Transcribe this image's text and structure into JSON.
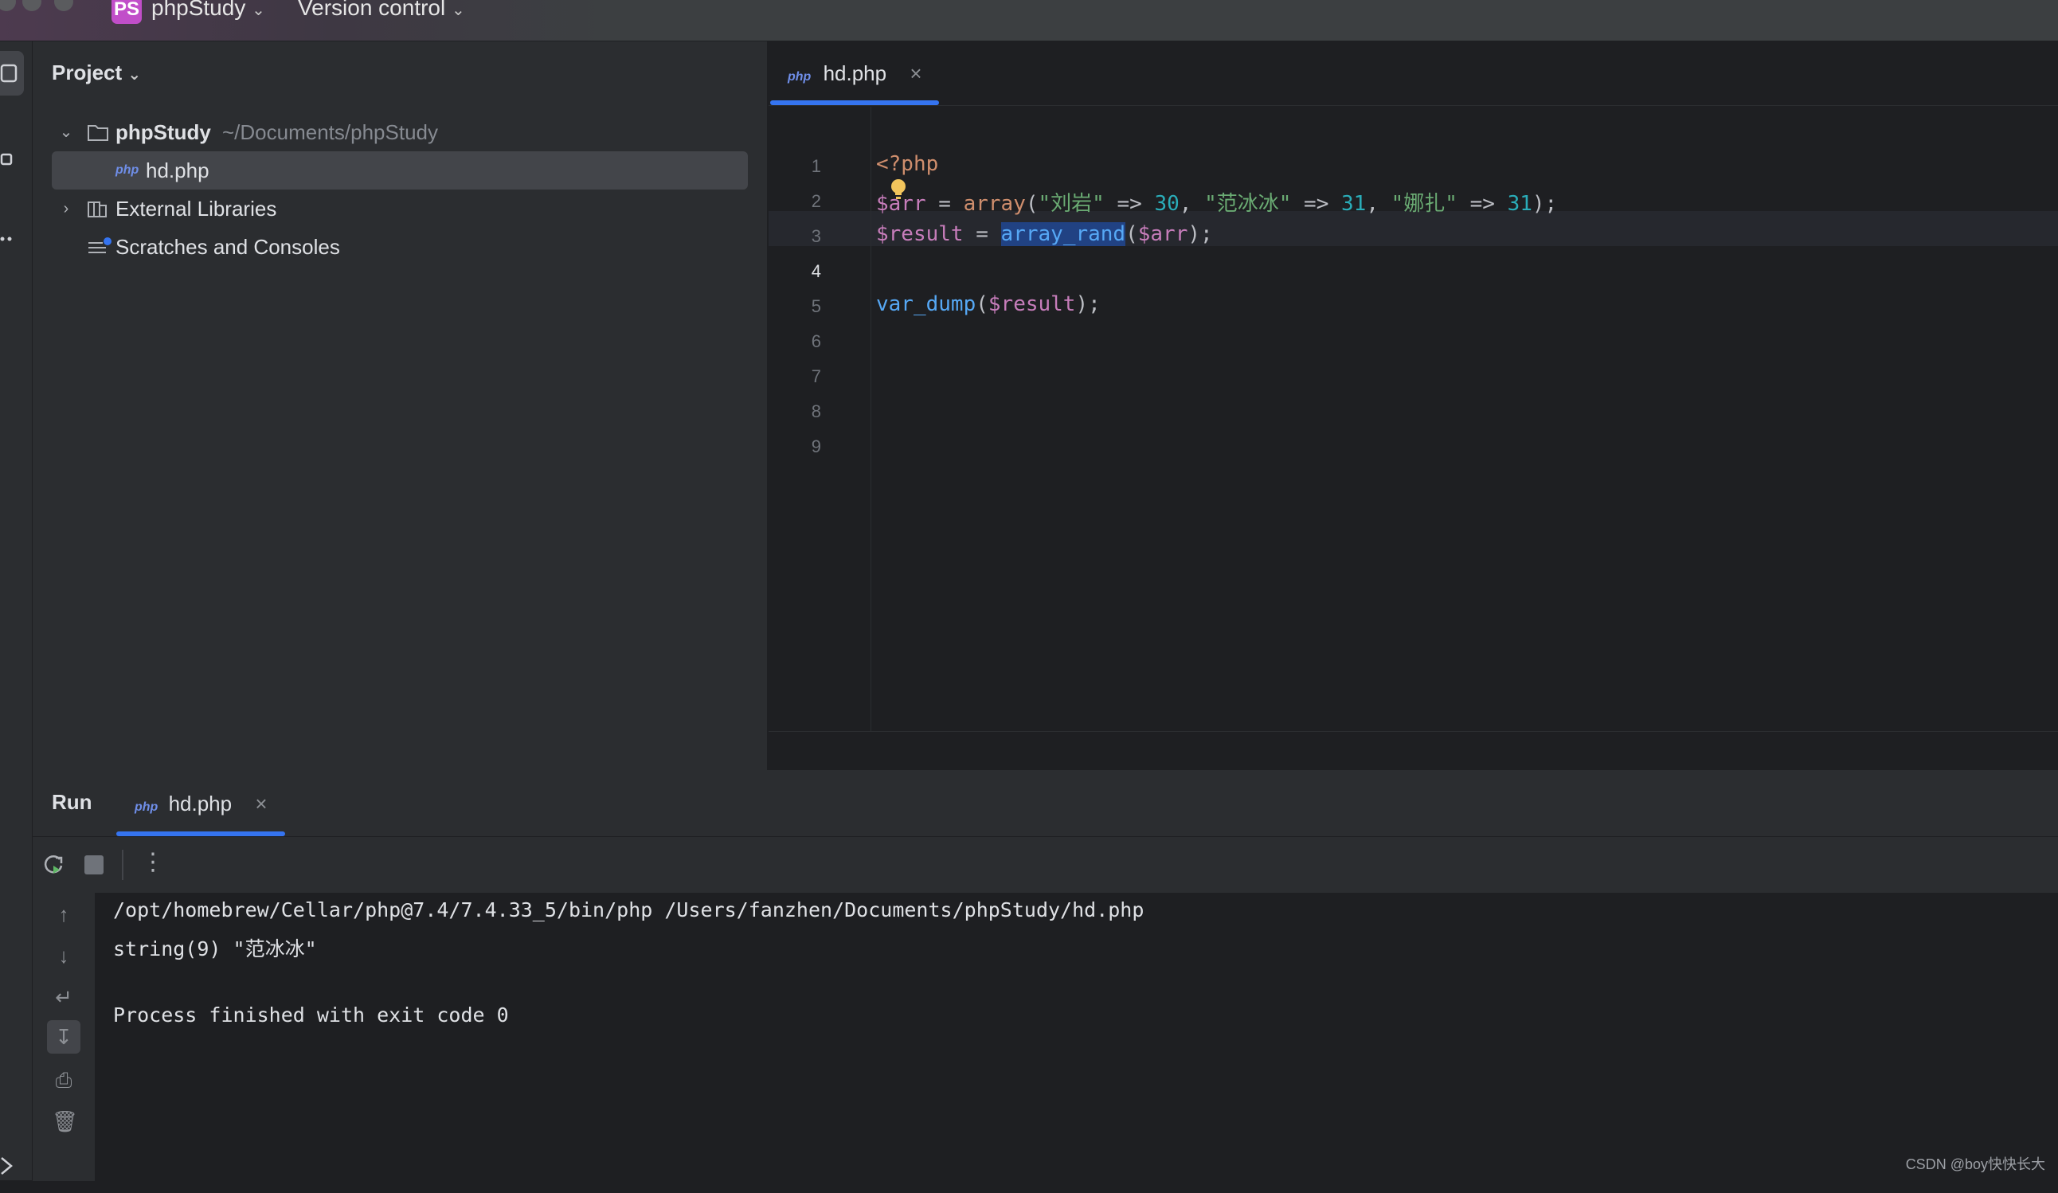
{
  "titlebar": {
    "badge": "PS",
    "project_name": "phpStudy",
    "vcs_label": "Version control"
  },
  "project_panel": {
    "title": "Project",
    "tree": [
      {
        "label": "phpStudy",
        "path": "~/Documents/phpStudy",
        "expanded": true
      },
      {
        "label": "hd.php",
        "badge": "php",
        "selected": true
      },
      {
        "label": "External Libraries",
        "expanded": false
      },
      {
        "label": "Scratches and Consoles"
      }
    ]
  },
  "editor": {
    "tab": {
      "badge": "php",
      "label": "hd.php",
      "close": "×"
    },
    "line_numbers": [
      "1",
      "2",
      "3",
      "4",
      "5",
      "6",
      "7",
      "8",
      "9"
    ],
    "current_line": 4,
    "lines": {
      "l1_open": "<?php",
      "l2_var": "$arr",
      "l2_eq": " = ",
      "l2_fn": "array",
      "l2_p1": "(",
      "l2_s1": "\"刘岩\"",
      "l2_arrow1": " => ",
      "l2_n1": "30",
      "l2_c1": ", ",
      "l2_s2": "\"范冰冰\"",
      "l2_arrow2": " => ",
      "l2_n2": "31",
      "l2_c2": ", ",
      "l2_s3": "\"娜扎\"",
      "l2_arrow3": " => ",
      "l2_n3": "31",
      "l2_end": ");",
      "l4_var": "$result",
      "l4_eq": " = ",
      "l4_fn": "array_rand",
      "l4_p1": "(",
      "l4_arg": "$arr",
      "l4_end": ");",
      "l6_fn": "var_dump",
      "l6_p1": "(",
      "l6_arg": "$result",
      "l6_end": ");"
    }
  },
  "run_panel": {
    "title": "Run",
    "tab": {
      "badge": "php",
      "label": "hd.php",
      "close": "×"
    },
    "output": [
      "/opt/homebrew/Cellar/php@7.4/7.4.33_5/bin/php /Users/fanzhen/Documents/phpStudy/hd.php",
      "string(9) \"范冰冰\"",
      "",
      "Process finished with exit code 0"
    ]
  },
  "watermark": "CSDN @boy快快长大",
  "colors": {
    "accent": "#3574f0",
    "variable": "#c77dbb",
    "function": "#56a8f5",
    "string": "#6aab73",
    "number": "#2aacb8",
    "keyword": "#cf8e6d",
    "badge": "#c14ec9"
  }
}
